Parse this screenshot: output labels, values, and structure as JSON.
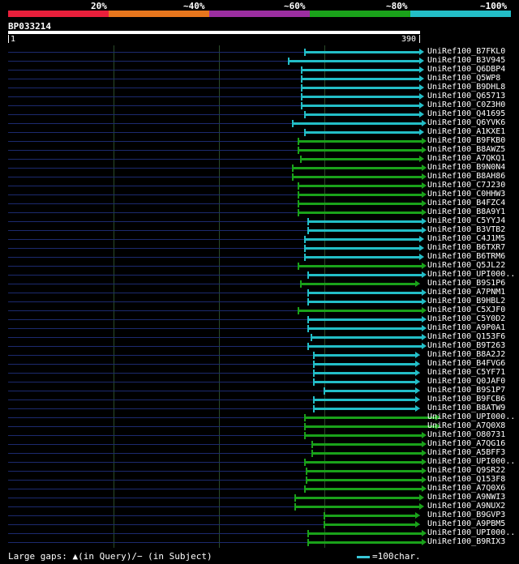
{
  "legend": {
    "labels": [
      "20%",
      "~40%",
      "~60%",
      "~80%",
      "~100%"
    ],
    "colors": [
      "#e81f3b",
      "#e6761d",
      "#9b2ea0",
      "#1aa21a",
      "#23bec7"
    ]
  },
  "query": {
    "name": "BP033214",
    "start": "1",
    "end": "390"
  },
  "footer": {
    "gaps_text": "Large gaps: ▲(in Query)/− (in Subject)",
    "scale_text": "=100char."
  },
  "hits": [
    {
      "name": "UniRef100_B7FKL0",
      "start": 280,
      "end": 390,
      "color": "#23bec7"
    },
    {
      "name": "UniRef100_B3V945",
      "start": 265,
      "end": 390,
      "color": "#23bec7"
    },
    {
      "name": "UniRef100_Q6DBP4",
      "start": 277,
      "end": 390,
      "color": "#23bec7"
    },
    {
      "name": "UniRef100_Q5WP8",
      "start": 277,
      "end": 390,
      "color": "#23bec7"
    },
    {
      "name": "UniRef100_B9DHL8",
      "start": 277,
      "end": 390,
      "color": "#23bec7"
    },
    {
      "name": "UniRef100_Q65713",
      "start": 277,
      "end": 390,
      "color": "#23bec7"
    },
    {
      "name": "UniRef100_C0Z3H0",
      "start": 277,
      "end": 390,
      "color": "#23bec7"
    },
    {
      "name": "UniRef100_Q41695",
      "start": 280,
      "end": 390,
      "color": "#23bec7"
    },
    {
      "name": "UniRef100_Q6YVK6",
      "start": 269,
      "end": 392,
      "color": "#23bec7"
    },
    {
      "name": "UniRef100_A1KXE1",
      "start": 280,
      "end": 390,
      "color": "#23bec7"
    },
    {
      "name": "UniRef100_B9FKB0",
      "start": 274,
      "end": 392,
      "color": "#1aa21a"
    },
    {
      "name": "UniRef100_B8AWZ5",
      "start": 274,
      "end": 392,
      "color": "#1aa21a"
    },
    {
      "name": "UniRef100_A7QKQ1",
      "start": 276,
      "end": 390,
      "color": "#1aa21a"
    },
    {
      "name": "UniRef100_B9N0N4",
      "start": 269,
      "end": 392,
      "color": "#1aa21a"
    },
    {
      "name": "UniRef100_B8AH86",
      "start": 269,
      "end": 392,
      "color": "#1aa21a"
    },
    {
      "name": "UniRef100_C7J230",
      "start": 274,
      "end": 392,
      "color": "#1aa21a"
    },
    {
      "name": "UniRef100_C0HHW3",
      "start": 274,
      "end": 392,
      "color": "#1aa21a"
    },
    {
      "name": "UniRef100_B4FZC4",
      "start": 274,
      "end": 392,
      "color": "#1aa21a"
    },
    {
      "name": "UniRef100_B8A9Y1",
      "start": 274,
      "end": 392,
      "color": "#1aa21a"
    },
    {
      "name": "UniRef100_C5YYJ4",
      "start": 283,
      "end": 392,
      "color": "#23bec7"
    },
    {
      "name": "UniRef100_B3VTB2",
      "start": 283,
      "end": 392,
      "color": "#23bec7"
    },
    {
      "name": "UniRef100_C4J1M5",
      "start": 280,
      "end": 390,
      "color": "#23bec7"
    },
    {
      "name": "UniRef100_B6TXR7",
      "start": 280,
      "end": 390,
      "color": "#23bec7"
    },
    {
      "name": "UniRef100_B6TRM6",
      "start": 280,
      "end": 390,
      "color": "#23bec7"
    },
    {
      "name": "UniRef100_Q5JL22",
      "start": 274,
      "end": 392,
      "color": "#1aa21a"
    },
    {
      "name": "UniRef100_UPI000..",
      "start": 283,
      "end": 392,
      "color": "#23bec7"
    },
    {
      "name": "UniRef100_B9S1P6",
      "start": 276,
      "end": 386,
      "color": "#1aa21a"
    },
    {
      "name": "UniRef100_A7PNM1",
      "start": 283,
      "end": 392,
      "color": "#23bec7"
    },
    {
      "name": "UniRef100_B9HBL2",
      "start": 283,
      "end": 392,
      "color": "#23bec7"
    },
    {
      "name": "UniRef100_C5XJF0",
      "start": 274,
      "end": 392,
      "color": "#1aa21a"
    },
    {
      "name": "UniRef100_C5Y0D2",
      "start": 283,
      "end": 392,
      "color": "#23bec7"
    },
    {
      "name": "UniRef100_A9P0A1",
      "start": 283,
      "end": 392,
      "color": "#23bec7"
    },
    {
      "name": "UniRef100_Q153F6",
      "start": 286,
      "end": 392,
      "color": "#23bec7"
    },
    {
      "name": "UniRef100_B9T263",
      "start": 283,
      "end": 392,
      "color": "#23bec7"
    },
    {
      "name": "UniRef100_B8A2J2",
      "start": 289,
      "end": 386,
      "color": "#23bec7"
    },
    {
      "name": "UniRef100_B4FVG6",
      "start": 289,
      "end": 386,
      "color": "#23bec7"
    },
    {
      "name": "UniRef100_C5YF71",
      "start": 289,
      "end": 386,
      "color": "#23bec7"
    },
    {
      "name": "UniRef100_Q0JAF0",
      "start": 289,
      "end": 386,
      "color": "#23bec7"
    },
    {
      "name": "UniRef100_B9S1P7",
      "start": 299,
      "end": 386,
      "color": "#23bec7"
    },
    {
      "name": "UniRef100_B9FCB6",
      "start": 289,
      "end": 386,
      "color": "#23bec7"
    },
    {
      "name": "UniRef100_B8ATW9",
      "start": 289,
      "end": 386,
      "color": "#23bec7"
    },
    {
      "name": "UniRef100_UPI000..",
      "start": 280,
      "end": 405,
      "color": "#1aa21a"
    },
    {
      "name": "UniRef100_A7Q0X8",
      "start": 280,
      "end": 405,
      "color": "#1aa21a"
    },
    {
      "name": "UniRef100_O80731",
      "start": 280,
      "end": 392,
      "color": "#1aa21a"
    },
    {
      "name": "UniRef100_A7QG16",
      "start": 287,
      "end": 392,
      "color": "#1aa21a"
    },
    {
      "name": "UniRef100_A5BFF3",
      "start": 287,
      "end": 392,
      "color": "#1aa21a"
    },
    {
      "name": "UniRef100_UPI000..",
      "start": 280,
      "end": 392,
      "color": "#1aa21a"
    },
    {
      "name": "UniRef100_Q9SR22",
      "start": 282,
      "end": 392,
      "color": "#1aa21a"
    },
    {
      "name": "UniRef100_Q153F8",
      "start": 282,
      "end": 392,
      "color": "#1aa21a"
    },
    {
      "name": "UniRef100_A7Q0X6",
      "start": 280,
      "end": 392,
      "color": "#1aa21a"
    },
    {
      "name": "UniRef100_A9NWI3",
      "start": 271,
      "end": 390,
      "color": "#1aa21a"
    },
    {
      "name": "UniRef100_A9NUX2",
      "start": 271,
      "end": 390,
      "color": "#1aa21a"
    },
    {
      "name": "UniRef100_B9GVP3",
      "start": 299,
      "end": 386,
      "color": "#1aa21a"
    },
    {
      "name": "UniRef100_A9PBM5",
      "start": 299,
      "end": 386,
      "color": "#1aa21a"
    },
    {
      "name": "UniRef100_UPI000..",
      "start": 283,
      "end": 392,
      "color": "#1aa21a"
    },
    {
      "name": "UniRef100_B9RIX3",
      "start": 283,
      "end": 392,
      "color": "#1aa21a"
    }
  ]
}
